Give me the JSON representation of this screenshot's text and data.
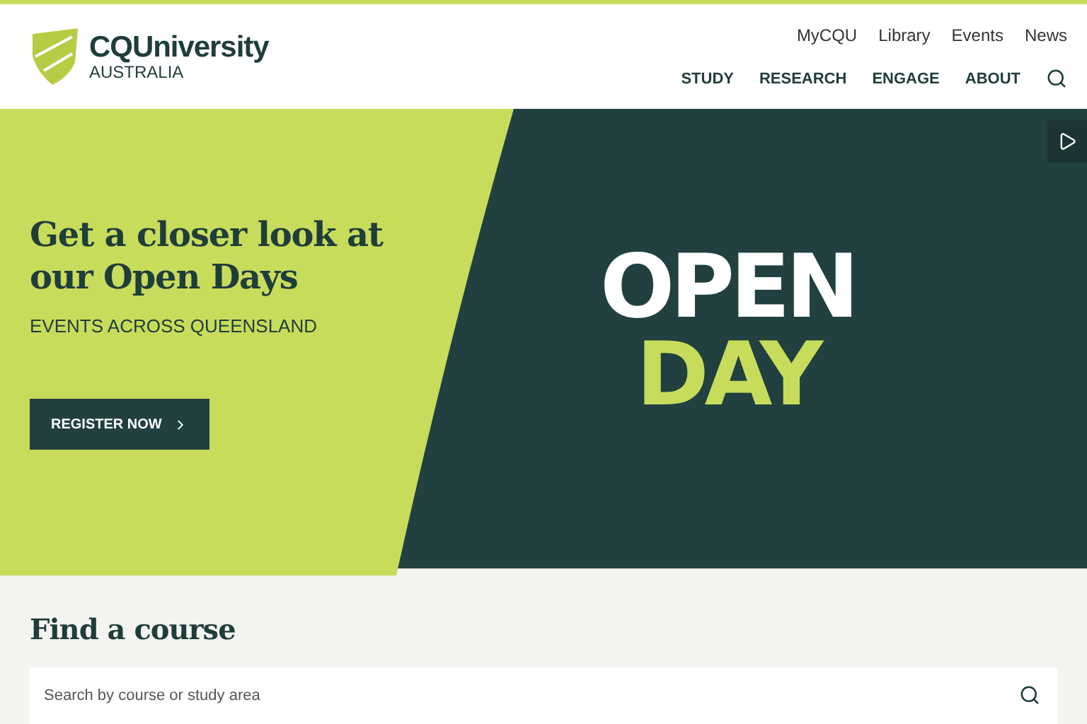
{
  "logo": {
    "name": "CQUniversity",
    "subtitle": "AUSTRALIA"
  },
  "utility_links": [
    "MyCQU",
    "Library",
    "Events",
    "News"
  ],
  "main_nav": [
    "STUDY",
    "RESEARCH",
    "ENGAGE",
    "ABOUT"
  ],
  "hero": {
    "heading": "Get a closer look at our Open Days",
    "subheading": "EVENTS ACROSS QUEENSLAND",
    "button": "REGISTER NOW",
    "graphic_lines": [
      "OPEN",
      "DAY"
    ]
  },
  "course_search": {
    "heading": "Find a course",
    "placeholder": "Search by course or study area"
  }
}
